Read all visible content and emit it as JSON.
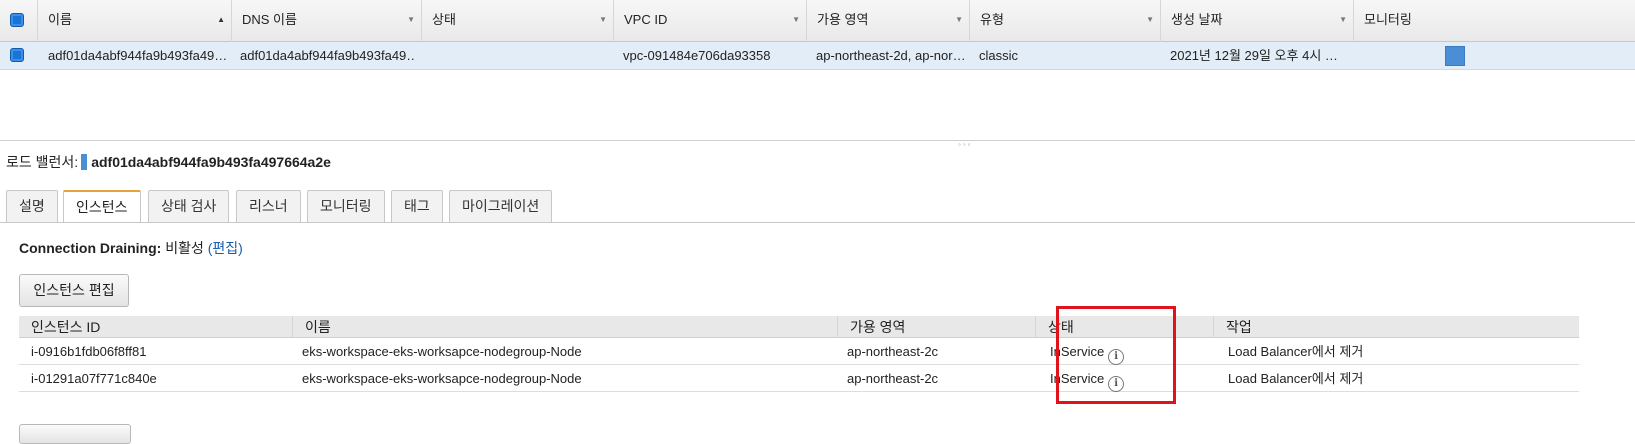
{
  "grid": {
    "columns": [
      {
        "label": "이름"
      },
      {
        "label": "DNS 이름"
      },
      {
        "label": "상태"
      },
      {
        "label": "VPC ID"
      },
      {
        "label": "가용 영역"
      },
      {
        "label": "유형"
      },
      {
        "label": "생성 날짜"
      },
      {
        "label": "모니터링"
      }
    ],
    "sort_asc_glyph": "▲",
    "sort_desc_glyph": "▼",
    "row": {
      "name": "adf01da4abf944fa9b493fa49…",
      "dns": "adf01da4abf944fa9b493fa49…",
      "state": "",
      "vpc_id": "vpc-091484e706da93358",
      "az": "ap-northeast-2d, ap-nor…",
      "type": "classic",
      "created": "2021년 12월 29일 오후 4시 …",
      "monitoring_color": "#4a8fd6"
    }
  },
  "splitter_grip": "◦◦◦",
  "lb": {
    "label": "로드 밸런서:",
    "name": "adf01da4abf944fa9b493fa497664a2e"
  },
  "tabs": [
    {
      "label": "설명"
    },
    {
      "label": "인스턴스",
      "active": true
    },
    {
      "label": "상태 검사"
    },
    {
      "label": "리스너"
    },
    {
      "label": "모니터링"
    },
    {
      "label": "태그"
    },
    {
      "label": "마이그레이션"
    }
  ],
  "connection_draining": {
    "label": "Connection Draining:",
    "value": "비활성",
    "edit_link": "(편집)"
  },
  "edit_instances_button": "인스턴스 편집",
  "instances": {
    "headers": [
      "인스턴스 ID",
      "이름",
      "가용 영역",
      "상태",
      "작업"
    ],
    "rows": [
      {
        "id": "i-0916b1fdb06f8ff81",
        "name": "eks-workspace-eks-worksapce-nodegroup-Node",
        "az": "ap-northeast-2c",
        "state": "InService",
        "action": "Load Balancer에서 제거"
      },
      {
        "id": "i-01291a07f771c840e",
        "name": "eks-workspace-eks-worksapce-nodegroup-Node",
        "az": "ap-northeast-2c",
        "state": "InService",
        "action": "Load Balancer에서 제거"
      }
    ],
    "info_glyph": "i"
  },
  "colors": {
    "accent_link": "#1a5ea8",
    "selected_row": "#e3edf7",
    "active_tab_top": "#e7a23b",
    "highlight_box": "#e0121b"
  }
}
